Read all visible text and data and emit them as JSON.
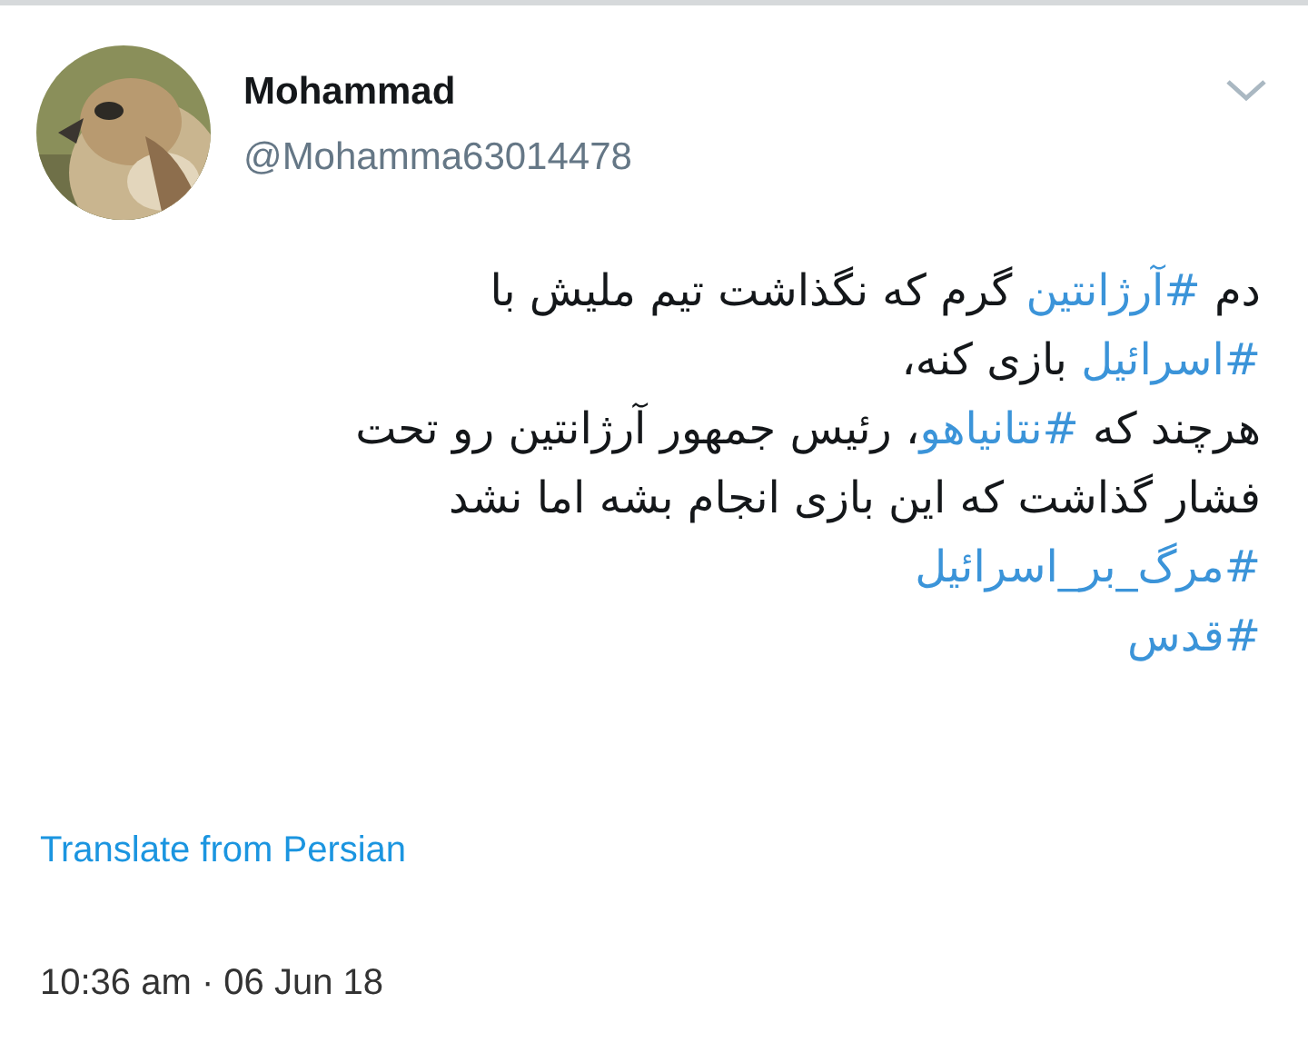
{
  "author": {
    "name": "Mohammad",
    "handle": "@Mohamma63014478"
  },
  "tweet_lines": [
    [
      {
        "text": "دم ",
        "kind": "text"
      },
      {
        "text": "#آرژانتین",
        "kind": "hashtag"
      },
      {
        "text": " گرم که نگذاشت تیم ملیش با",
        "kind": "text"
      }
    ],
    [
      {
        "text": "#اسرائیل",
        "kind": "hashtag"
      },
      {
        "text": " بازی کنه،",
        "kind": "text"
      }
    ],
    [
      {
        "text": "هرچند که ",
        "kind": "text"
      },
      {
        "text": "#نتانیاهو",
        "kind": "hashtag"
      },
      {
        "text": "، رئیس جمهور آرژانتین رو تحت",
        "kind": "text"
      }
    ],
    [
      {
        "text": "فشار گذاشت که این بازی انجام بشه اما نشد",
        "kind": "text"
      }
    ],
    [
      {
        "text": "#مرگ_بر_اسرائیل",
        "kind": "hashtag"
      }
    ],
    [
      {
        "text": "#قدس",
        "kind": "hashtag"
      }
    ]
  ],
  "translate_link": "Translate from Persian",
  "timestamp": "10:36 am · 06 Jun 18"
}
